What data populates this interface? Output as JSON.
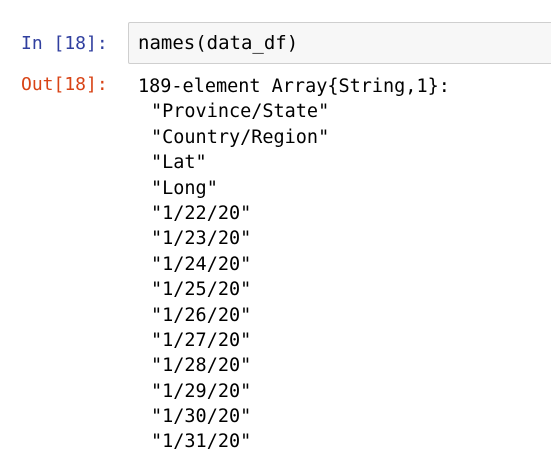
{
  "cell": {
    "in_prompt": "In [18]:",
    "out_prompt": "Out[18]:",
    "code": {
      "func": "names",
      "open_paren": "(",
      "arg": "data_df",
      "close_paren": ")"
    },
    "output": {
      "header": "189-element Array{String,1}:",
      "items": [
        "\"Province/State\"",
        "\"Country/Region\"",
        "\"Lat\"",
        "\"Long\"",
        "\"1/22/20\"",
        "\"1/23/20\"",
        "\"1/24/20\"",
        "\"1/25/20\"",
        "\"1/26/20\"",
        "\"1/27/20\"",
        "\"1/28/20\"",
        "\"1/29/20\"",
        "\"1/30/20\"",
        "\"1/31/20\""
      ]
    }
  },
  "colors": {
    "in_prompt": "#303f9f",
    "out_prompt": "#d84315",
    "input_background": "#f7f7f7",
    "input_border": "#cfcfcf"
  }
}
